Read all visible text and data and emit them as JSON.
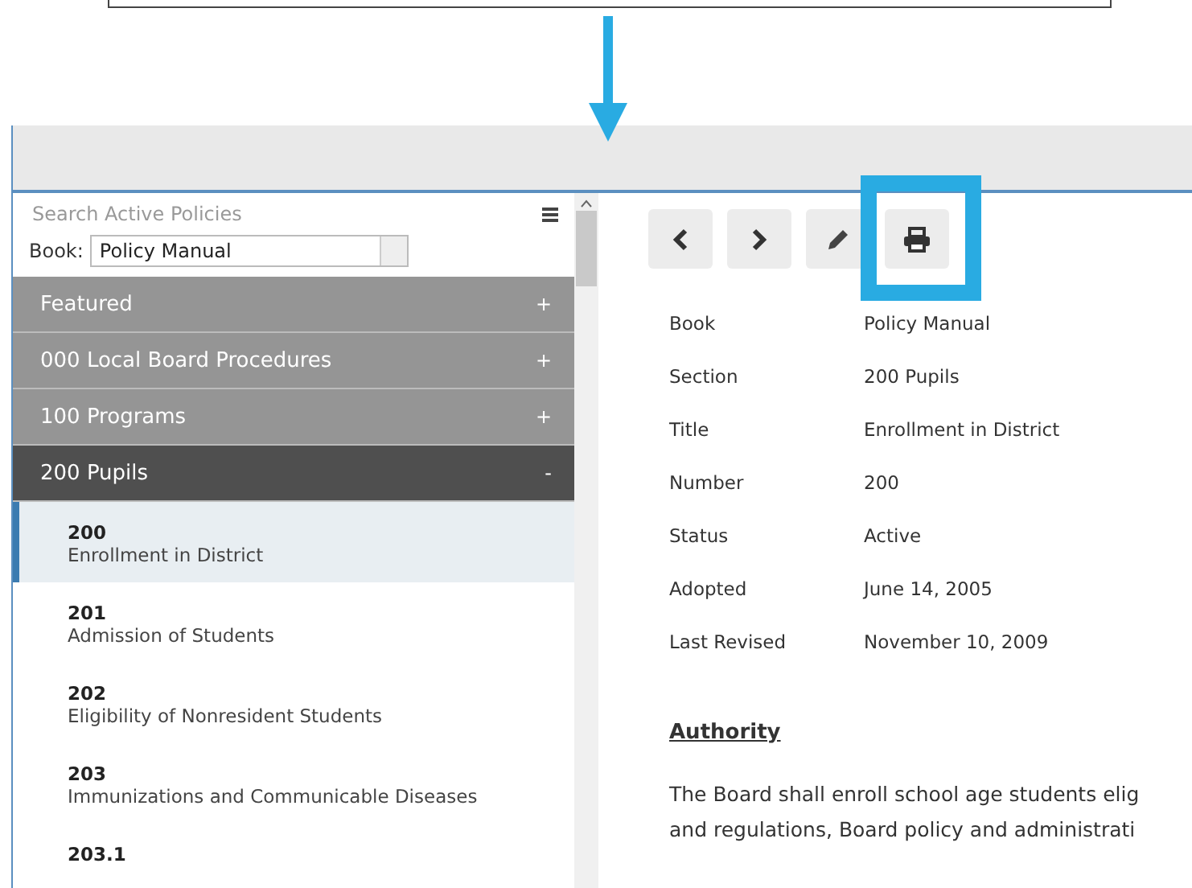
{
  "sidebar": {
    "search": {
      "placeholder": "Search Active Policies"
    },
    "book": {
      "label": "Book:",
      "value": "Policy Manual"
    },
    "sections": [
      {
        "label": "Featured",
        "sign": "+",
        "expanded": false
      },
      {
        "label": "000 Local Board Procedures",
        "sign": "+",
        "expanded": false
      },
      {
        "label": "100 Programs",
        "sign": "+",
        "expanded": false
      },
      {
        "label": "200 Pupils",
        "sign": "-",
        "expanded": true
      }
    ],
    "policies": [
      {
        "number": "200",
        "title": "Enrollment in District",
        "selected": true
      },
      {
        "number": "201",
        "title": "Admission of Students",
        "selected": false
      },
      {
        "number": "202",
        "title": "Eligibility of Nonresident Students",
        "selected": false
      },
      {
        "number": "203",
        "title": "Immunizations and Communicable Diseases",
        "selected": false
      },
      {
        "number": "203.1",
        "selected": false
      }
    ]
  },
  "details": [
    {
      "label": "Book",
      "value": "Policy Manual"
    },
    {
      "label": "Section",
      "value": "200 Pupils"
    },
    {
      "label": "Title",
      "value": "Enrollment in District"
    },
    {
      "label": "Number",
      "value": "200"
    },
    {
      "label": "Status",
      "value": "Active"
    },
    {
      "label": "Adopted",
      "value": "June 14, 2005"
    },
    {
      "label": "Last Revised",
      "value": "November 10, 2009"
    }
  ],
  "heading": "Authority",
  "body_lines": [
    "The Board shall enroll school age students elig",
    "and regulations, Board policy and administrati"
  ]
}
